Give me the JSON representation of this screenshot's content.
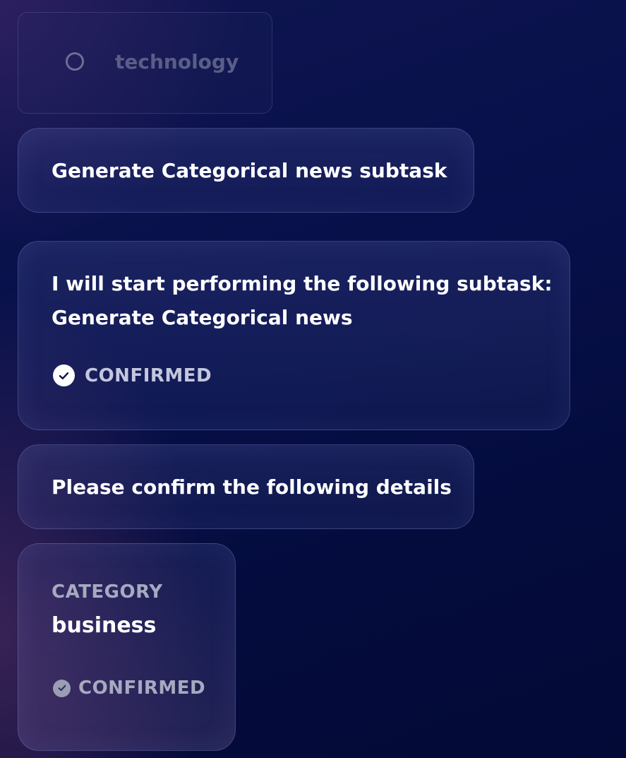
{
  "option": {
    "label": "technology",
    "icon": "radio-unselected-icon"
  },
  "messages": [
    {
      "text": "Generate Categorical news subtask"
    },
    {
      "line1": "I will start performing the following subtask:",
      "line2": "Generate Categorical news",
      "status": "CONFIRMED",
      "status_icon": "check-circle-icon"
    },
    {
      "text": "Please confirm the following details"
    },
    {
      "field_label": "CATEGORY",
      "field_value": "business",
      "status": "CONFIRMED",
      "status_icon": "check-circle-icon"
    }
  ],
  "colors": {
    "background": "#050d40",
    "bubble_border": "#5a63a0",
    "muted_text": "#a7aac0"
  }
}
